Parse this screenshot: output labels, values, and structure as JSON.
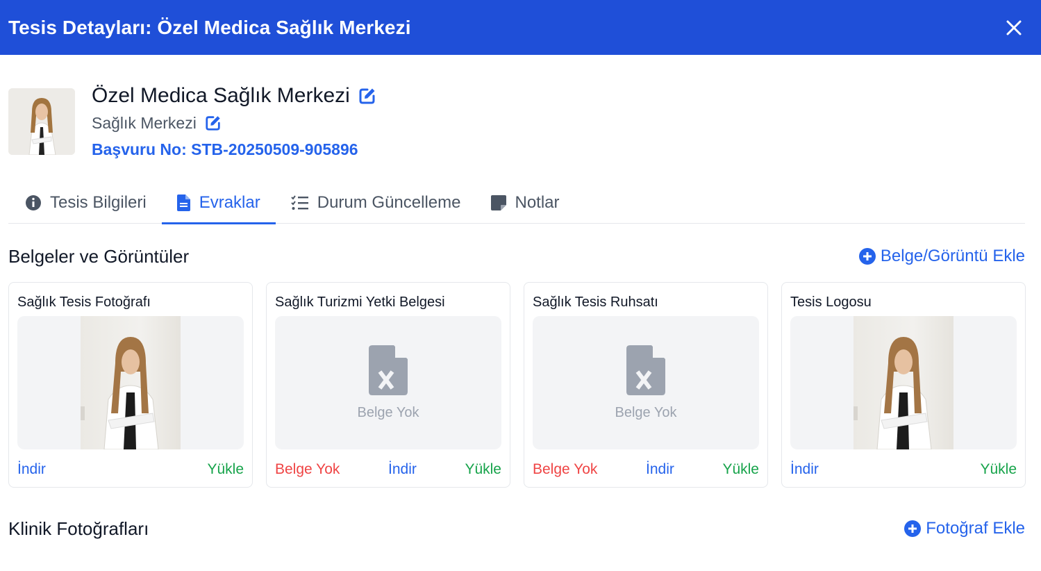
{
  "header": {
    "title": "Tesis Detayları: Özel Medica Sağlık Merkezi",
    "close_icon": "close-icon"
  },
  "profile": {
    "name": "Özel Medica Sağlık Merkezi",
    "type": "Sağlık Merkezi",
    "application_no": "Başvuru No: STB-20250509-905896"
  },
  "tabs": [
    {
      "label": "Tesis Bilgileri",
      "icon": "info-circle-icon"
    },
    {
      "label": "Evraklar",
      "icon": "document-icon",
      "active": true
    },
    {
      "label": "Durum Güncelleme",
      "icon": "checklist-icon"
    },
    {
      "label": "Notlar",
      "icon": "sticky-note-icon"
    }
  ],
  "documents_section": {
    "title": "Belgeler ve Görüntüler",
    "add_label": "Belge/Görüntü Ekle",
    "cards": [
      {
        "title": "Sağlık Tesis Fotoğrafı",
        "has_file": true,
        "download": "İndir",
        "upload": "Yükle"
      },
      {
        "title": "Sağlık Turizmi Yetki Belgesi",
        "has_file": false,
        "empty_label": "Belge Yok",
        "missing": "Belge Yok",
        "download": "İndir",
        "upload": "Yükle"
      },
      {
        "title": "Sağlık Tesis Ruhsatı",
        "has_file": false,
        "empty_label": "Belge Yok",
        "missing": "Belge Yok",
        "download": "İndir",
        "upload": "Yükle"
      },
      {
        "title": "Tesis Logosu",
        "has_file": true,
        "download": "İndir",
        "upload": "Yükle"
      }
    ]
  },
  "photos_section": {
    "title": "Klinik Fotoğrafları",
    "add_label": "Fotoğraf Ekle"
  },
  "colors": {
    "header_bg": "#1f4fd8",
    "accent": "#2563eb",
    "danger": "#ef4444",
    "success": "#16a34a",
    "muted": "#9ca3af"
  }
}
